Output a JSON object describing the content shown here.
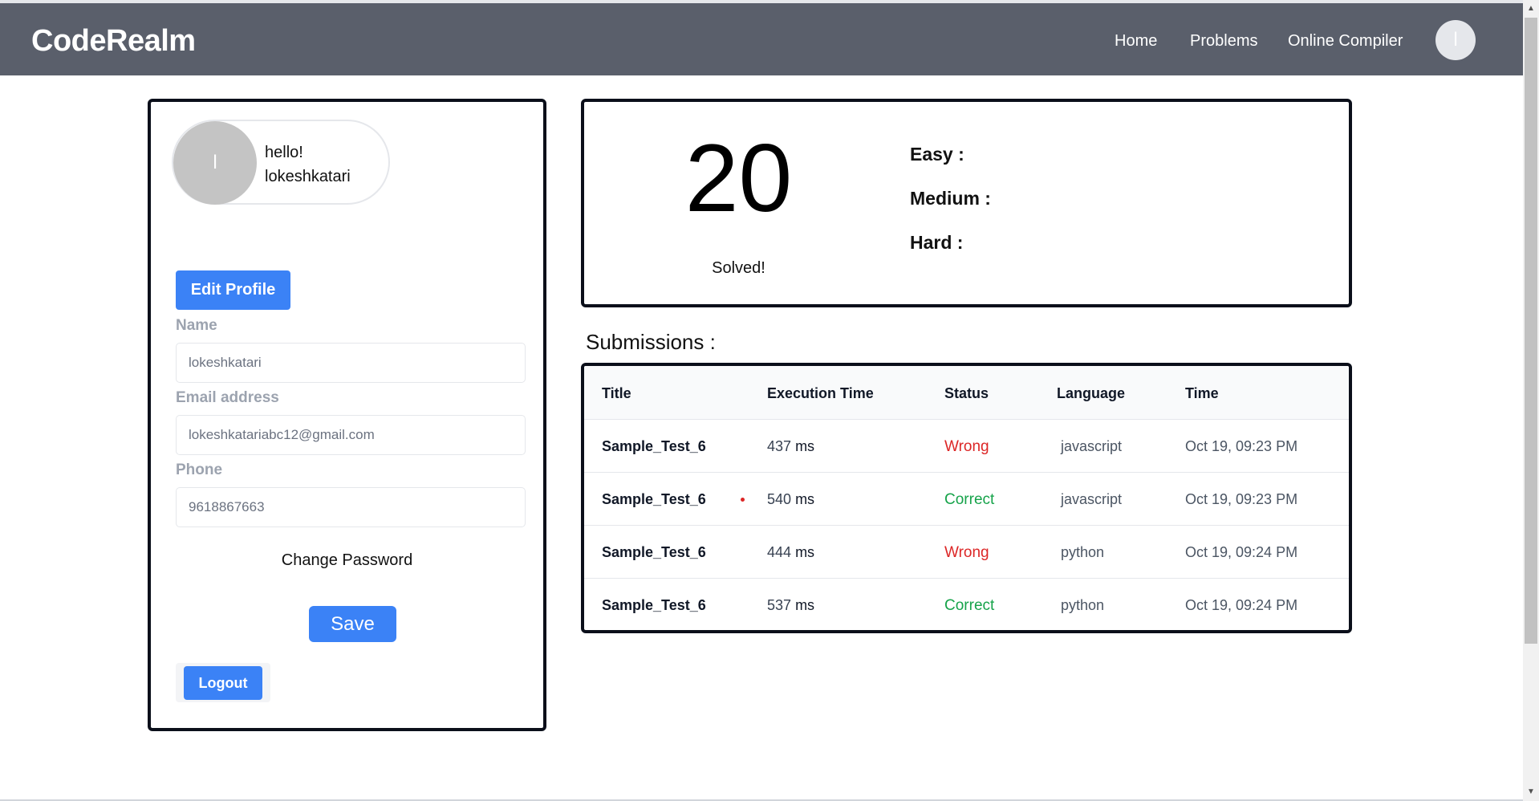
{
  "navbar": {
    "brand": "CodeRealm",
    "links": [
      "Home",
      "Problems",
      "Online Compiler"
    ],
    "avatar_initial": "l"
  },
  "profile": {
    "avatar_initial": "l",
    "greeting": "hello!",
    "username": "lokeshkatari",
    "edit_label": "Edit Profile",
    "fields": {
      "name_label": "Name",
      "name_value": "lokeshkatari",
      "email_label": "Email address",
      "email_value": "lokeshkatariabc12@gmail.com",
      "phone_label": "Phone",
      "phone_value": "9618867663"
    },
    "change_password": "Change Password",
    "save_label": "Save",
    "logout_label": "Logout"
  },
  "stats": {
    "solved_count": "20",
    "solved_label": "Solved!",
    "easy_label": "Easy :",
    "medium_label": "Medium :",
    "hard_label": "Hard :"
  },
  "submissions": {
    "title": "Submissions :",
    "headers": [
      "Title",
      "Execution Time",
      "Status",
      "Language",
      "Time"
    ],
    "ms_unit": "ms",
    "rows": [
      {
        "title": "Sample_Test_6",
        "exec": "437",
        "status": "Wrong",
        "language": "javascript",
        "time": "Oct 19, 09:23 PM"
      },
      {
        "title": "Sample_Test_6",
        "exec": "540",
        "status": "Correct",
        "language": "javascript",
        "time": "Oct 19, 09:23 PM"
      },
      {
        "title": "Sample_Test_6",
        "exec": "444",
        "status": "Wrong",
        "language": "python",
        "time": "Oct 19, 09:24 PM"
      },
      {
        "title": "Sample_Test_6",
        "exec": "537",
        "status": "Correct",
        "language": "python",
        "time": "Oct 19, 09:24 PM"
      }
    ]
  },
  "colors": {
    "navbar_bg": "#5a5f6b",
    "primary_button": "#3b82f6",
    "wrong": "#dc2626",
    "correct": "#16a34a"
  }
}
